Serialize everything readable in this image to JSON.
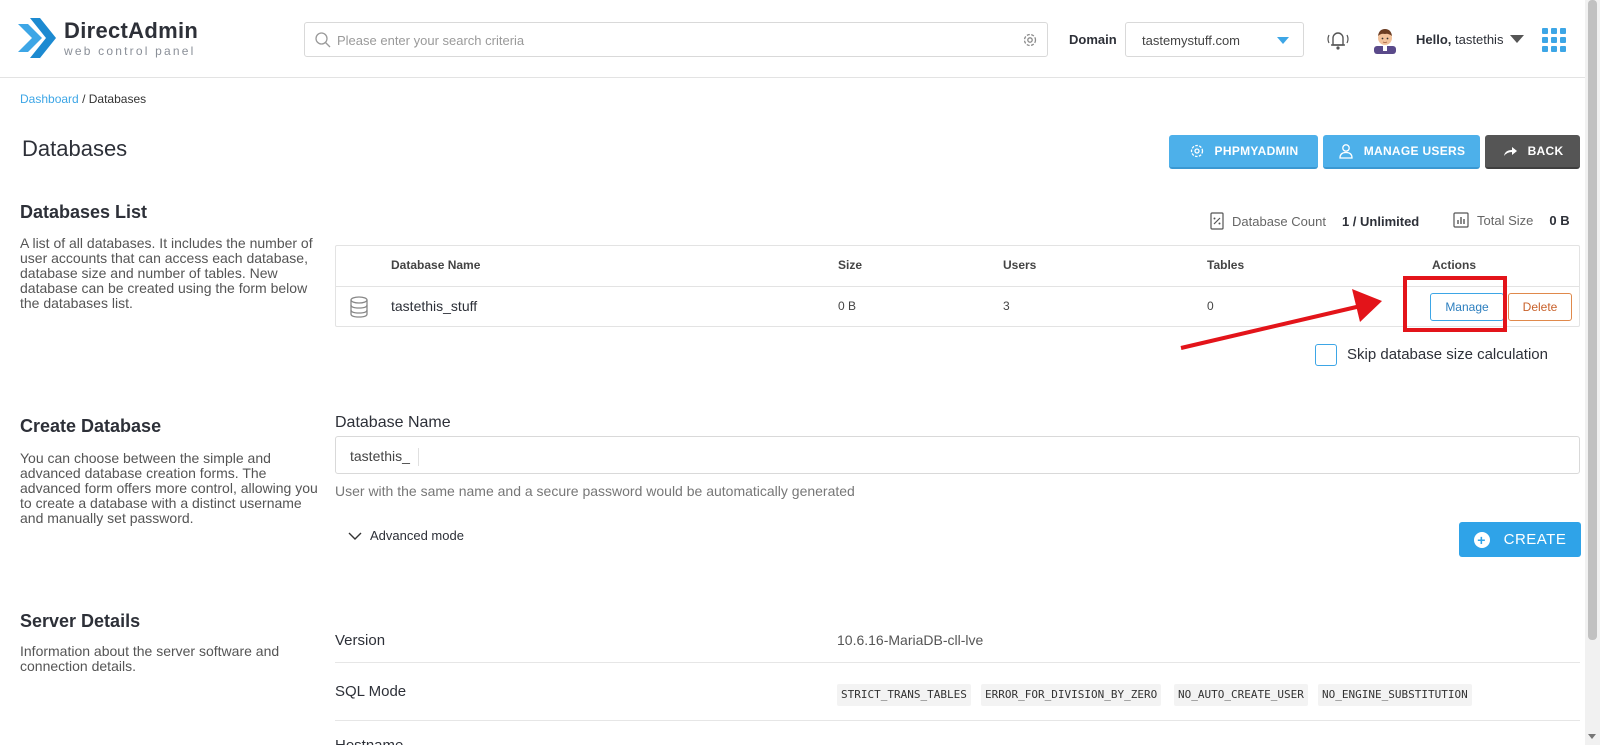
{
  "header": {
    "logo_title": "DirectAdmin",
    "logo_subtitle": "web control panel",
    "search_placeholder": "Please enter your search criteria",
    "domain_label": "Domain",
    "domain_value": "tastemystuff.com",
    "hello_prefix": "Hello,",
    "username": "tastethis"
  },
  "breadcrumb": {
    "dashboard": "Dashboard",
    "separator": "/",
    "current": "Databases"
  },
  "page": {
    "title": "Databases"
  },
  "actions": {
    "phpmyadmin": "PHPMYADMIN",
    "manage_users": "MANAGE USERS",
    "back": "BACK"
  },
  "databases_list": {
    "title": "Databases List",
    "description": "A list of all databases. It includes the number of user accounts that can access each database, database size and number of tables. New database can be created using the form below the databases list.",
    "count_label": "Database Count",
    "count_value": "1 / Unlimited",
    "size_label": "Total Size",
    "size_value": "0 B",
    "columns": [
      "Database Name",
      "Size",
      "Users",
      "Tables",
      "Actions"
    ],
    "rows": [
      {
        "name": "tastethis_stuff",
        "size": "0 B",
        "users": "3",
        "tables": "0",
        "manage": "Manage",
        "delete": "Delete"
      }
    ],
    "skip_label": "Skip database size calculation"
  },
  "create_database": {
    "title": "Create Database",
    "description": "You can choose between the simple and advanced database creation forms. The advanced form offers more control, allowing you to create a database with a distinct username and manually set password.",
    "field_label": "Database Name",
    "prefix": "tastethis_",
    "hint": "User with the same name and a secure password would be automatically generated",
    "advanced_label": "Advanced mode",
    "create_label": "CREATE"
  },
  "server_details": {
    "title": "Server Details",
    "description": "Information about the server software and connection details.",
    "version_label": "Version",
    "version_value": "10.6.16-MariaDB-cll-lve",
    "sql_mode_label": "SQL Mode",
    "sql_modes": [
      "STRICT_TRANS_TABLES",
      "ERROR_FOR_DIVISION_BY_ZERO",
      "NO_AUTO_CREATE_USER",
      "NO_ENGINE_SUBSTITUTION"
    ],
    "hostname_label": "Hostname"
  },
  "colors": {
    "accent": "#3da6e6",
    "highlight": "#e3141a",
    "delete": "#c8612a"
  }
}
